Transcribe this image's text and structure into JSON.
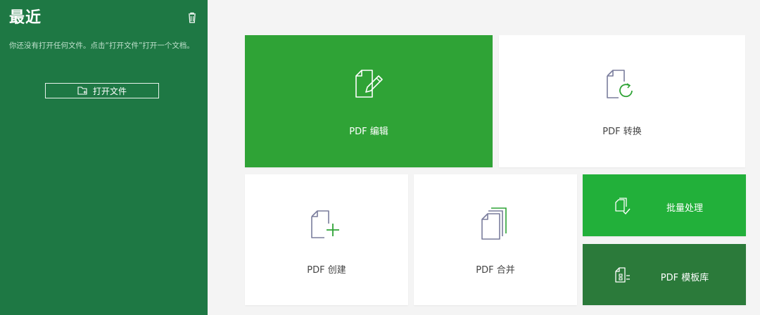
{
  "sidebar": {
    "title": "最近",
    "empty_message": "你还没有打开任何文件。点击“打开文件”打开一个文档。",
    "open_button_label": "打开文件",
    "background_color": "#1e7844"
  },
  "tiles": {
    "edit": {
      "label": "PDF 编辑",
      "color": "#2fa336"
    },
    "convert": {
      "label": "PDF 转换",
      "color": "#ffffff"
    },
    "create": {
      "label": "PDF 创建",
      "color": "#ffffff"
    },
    "merge": {
      "label": "PDF 合并",
      "color": "#ffffff"
    },
    "batch": {
      "label": "批量处理",
      "color": "#22b03a"
    },
    "template": {
      "label": "PDF 模板库",
      "color": "#2b7a3a"
    }
  },
  "icons": {
    "trash": "trash-icon",
    "open_folder": "folder-open-icon",
    "edit": "document-edit-icon",
    "convert": "document-convert-icon",
    "create": "document-add-icon",
    "merge": "document-merge-icon",
    "batch": "batch-icon",
    "template": "template-icon"
  }
}
